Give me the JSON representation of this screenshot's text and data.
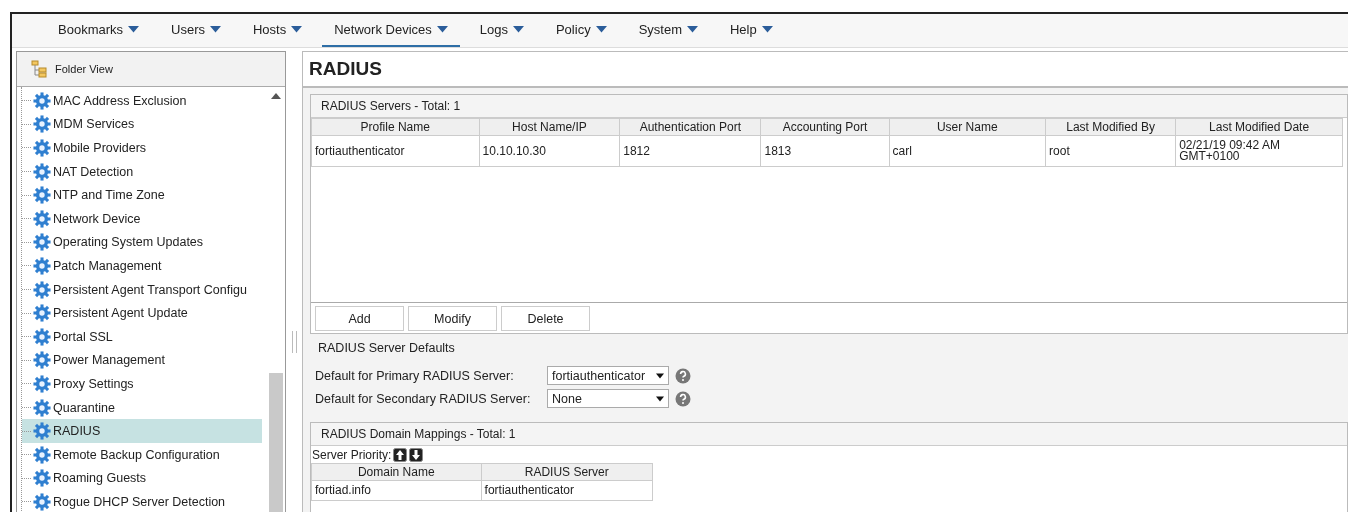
{
  "menu": [
    {
      "label": "Bookmarks",
      "selected": false
    },
    {
      "label": "Users",
      "selected": false
    },
    {
      "label": "Hosts",
      "selected": false
    },
    {
      "label": "Network Devices",
      "selected": true
    },
    {
      "label": "Logs",
      "selected": false
    },
    {
      "label": "Policy",
      "selected": false
    },
    {
      "label": "System",
      "selected": false
    },
    {
      "label": "Help",
      "selected": false
    }
  ],
  "sidebar": {
    "title": "Folder View",
    "items": [
      {
        "label": "MAC Address Exclusion",
        "selected": false
      },
      {
        "label": "MDM Services",
        "selected": false
      },
      {
        "label": "Mobile Providers",
        "selected": false
      },
      {
        "label": "NAT Detection",
        "selected": false
      },
      {
        "label": "NTP and Time Zone",
        "selected": false
      },
      {
        "label": "Network Device",
        "selected": false
      },
      {
        "label": "Operating System Updates",
        "selected": false
      },
      {
        "label": "Patch Management",
        "selected": false
      },
      {
        "label": "Persistent Agent Transport Configu",
        "selected": false
      },
      {
        "label": "Persistent Agent Update",
        "selected": false
      },
      {
        "label": "Portal SSL",
        "selected": false
      },
      {
        "label": "Power Management",
        "selected": false
      },
      {
        "label": "Proxy Settings",
        "selected": false
      },
      {
        "label": "Quarantine",
        "selected": false
      },
      {
        "label": "RADIUS",
        "selected": true
      },
      {
        "label": "Remote Backup Configuration",
        "selected": false
      },
      {
        "label": "Roaming Guests",
        "selected": false
      },
      {
        "label": "Rogue DHCP Server Detection",
        "selected": false
      }
    ]
  },
  "page": {
    "title": "RADIUS"
  },
  "servers": {
    "title": "RADIUS Servers - Total: 1",
    "columns": [
      "Profile Name",
      "Host Name/IP",
      "Authentication Port",
      "Accounting Port",
      "User Name",
      "Last Modified By",
      "Last Modified Date"
    ],
    "rows": [
      [
        "fortiauthenticator",
        "10.10.10.30",
        "1812",
        "1813",
        "carl",
        "root",
        "02/21/19 09:42 AM GMT+0100"
      ]
    ],
    "buttons": [
      "Add",
      "Modify",
      "Delete"
    ]
  },
  "defaults": {
    "title": "RADIUS Server Defaults",
    "fields": [
      {
        "label": "Default for Primary RADIUS Server:",
        "value": "fortiauthenticator"
      },
      {
        "label": "Default for Secondary RADIUS Server:",
        "value": "None"
      }
    ]
  },
  "mappings": {
    "title": "RADIUS Domain Mappings - Total: 1",
    "priority_label": "Server Priority:",
    "columns": [
      "Domain Name",
      "RADIUS Server"
    ],
    "rows": [
      [
        "fortiad.info",
        "fortiauthenticator"
      ]
    ]
  }
}
